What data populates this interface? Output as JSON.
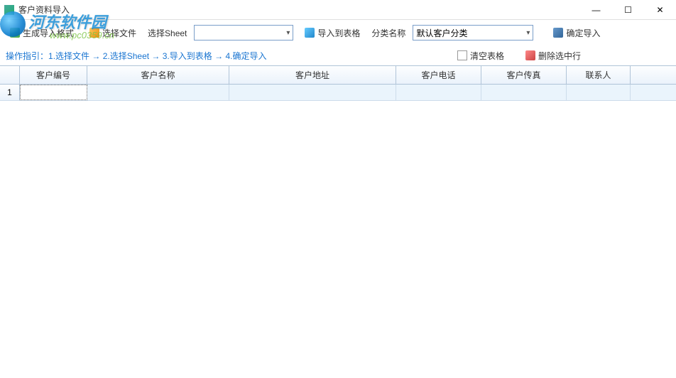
{
  "window": {
    "title": "客户资料导入"
  },
  "toolbar": {
    "gen_format": "生成导入格式",
    "choose_file": "选择文件",
    "choose_sheet_label": "选择Sheet",
    "sheet_value": "",
    "import_to_grid": "导入到表格",
    "category_label": "分类名称",
    "category_value": "默认客户分类",
    "confirm_import": "确定导入"
  },
  "hint": {
    "prefix": "操作指引：",
    "s1": "1.选择文件",
    "arrow": " → ",
    "s2": "2.选择Sheet",
    "s3": "3.导入到表格",
    "s4": "4.确定导入",
    "clear_grid": "清空表格",
    "delete_row": "删除选中行"
  },
  "grid": {
    "headers": {
      "id": "客户编号",
      "name": "客户名称",
      "addr": "客户地址",
      "phone": "客户电话",
      "fax": "客户传真",
      "contact": "联系人"
    },
    "rows": [
      {
        "num": "1",
        "id": "",
        "name": "",
        "addr": "",
        "phone": "",
        "fax": "",
        "contact": ""
      }
    ]
  },
  "watermark": {
    "line1": "河东软件园",
    "line2": "www.pc0359.cn"
  }
}
